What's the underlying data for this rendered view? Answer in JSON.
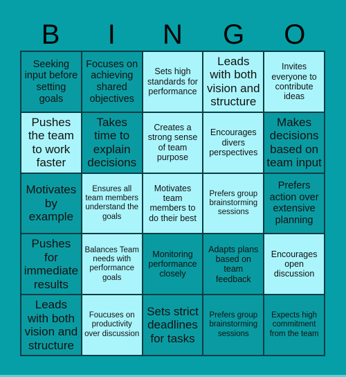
{
  "header": {
    "letters": [
      "B",
      "I",
      "N",
      "G",
      "O"
    ]
  },
  "colors": {
    "background": "#069fa8",
    "dark_cell": "#0a9ba2",
    "light_cell": "#aaf5fc",
    "border": "#0b3d44"
  },
  "cells": [
    [
      {
        "text": "Seeking input before setting goals",
        "style": "dark"
      },
      {
        "text": "Focuses on achieving shared objectives",
        "style": "dark"
      },
      {
        "text": "Sets high standards for performance",
        "style": "light"
      },
      {
        "text": "Leads with both vision and structure",
        "style": "light"
      },
      {
        "text": "Invites everyone to contribute ideas",
        "style": "light"
      }
    ],
    [
      {
        "text": "Pushes the team to work faster",
        "style": "light"
      },
      {
        "text": "Takes time to explain decisions",
        "style": "dark"
      },
      {
        "text": "Creates a strong sense of team purpose",
        "style": "light"
      },
      {
        "text": "Encourages divers perspectives",
        "style": "light"
      },
      {
        "text": "Makes decisions based on team input",
        "style": "dark"
      }
    ],
    [
      {
        "text": "Motivates by example",
        "style": "dark"
      },
      {
        "text": "Ensures all team members understand the goals",
        "style": "light"
      },
      {
        "text": "Motivates team members to do their best",
        "style": "light"
      },
      {
        "text": "Prefers group brainstorming sessions",
        "style": "light"
      },
      {
        "text": "Prefers action over extensive planning",
        "style": "dark"
      }
    ],
    [
      {
        "text": "Pushes for immediate results",
        "style": "dark"
      },
      {
        "text": "Balances Team needs with performance goals",
        "style": "light"
      },
      {
        "text": "Monitoring performance closely",
        "style": "dark"
      },
      {
        "text": "Adapts plans based on team feedback",
        "style": "dark"
      },
      {
        "text": "Encourages open discussion",
        "style": "light"
      }
    ],
    [
      {
        "text": "Leads with both vision and structure",
        "style": "dark"
      },
      {
        "text": "Foucuses on productivity over discussion",
        "style": "light"
      },
      {
        "text": "Sets strict deadlines for tasks",
        "style": "dark"
      },
      {
        "text": "Prefers group brainstorming sessions",
        "style": "dark"
      },
      {
        "text": "Expects high commitment from the team",
        "style": "dark"
      }
    ]
  ]
}
